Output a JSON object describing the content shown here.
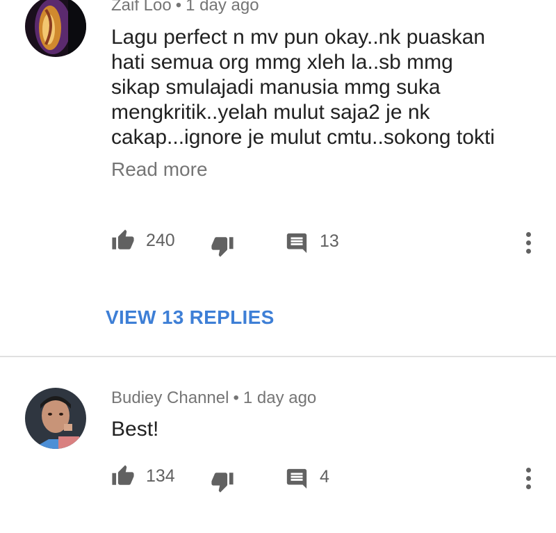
{
  "comments": [
    {
      "author": "Zaif Loo",
      "separator": "•",
      "time": "1 day ago",
      "text": [
        "Lagu perfect n mv pun okay..nk puaskan",
        "hati semua org mmg xleh la..sb mmg",
        "sikap smulajadi manusia mmg suka",
        "mengkritik..yelah mulut saja2 je nk",
        "cakap...ignore je mulut cmtu..sokong tokti"
      ],
      "read_more": "Read more",
      "likes": "240",
      "replies_count": "13",
      "view_replies": "VIEW 13 REPLIES",
      "avatar_icon": "avatar-abstract"
    },
    {
      "author": "Budiey Channel",
      "separator": "•",
      "time": "1 day ago",
      "text": [
        "Best!"
      ],
      "likes": "134",
      "replies_count": "4",
      "avatar_icon": "avatar-photo"
    }
  ],
  "colors": {
    "accent": "#3e7fd6",
    "meta": "#757575",
    "icon": "#616161",
    "text": "#212121"
  }
}
